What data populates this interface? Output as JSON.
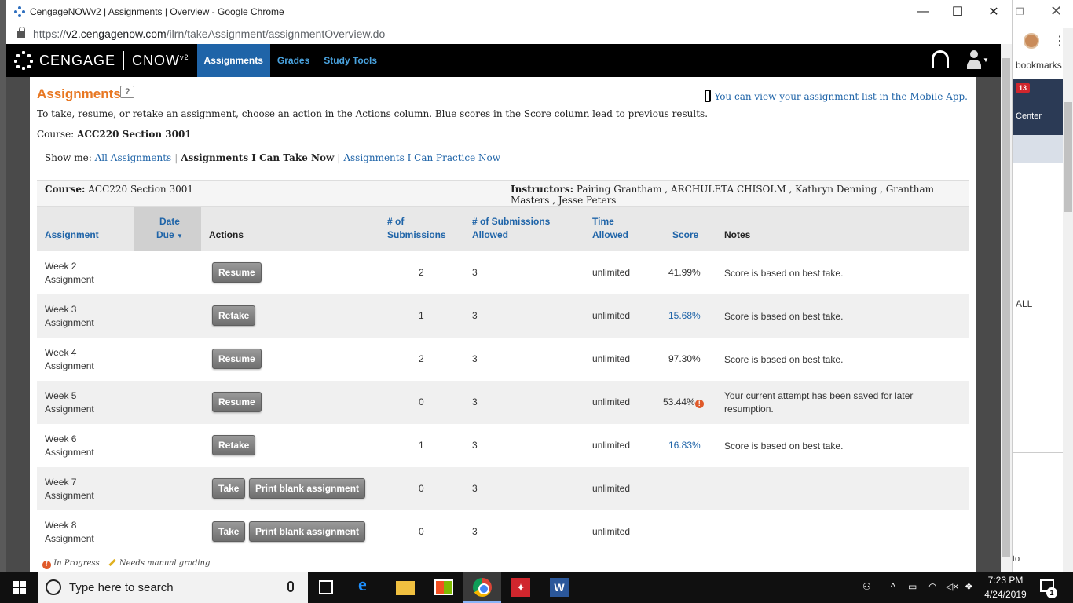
{
  "browser": {
    "title": "CengageNOWv2 | Assignments | Overview - Google Chrome",
    "url_scheme": "https://",
    "url_host": "v2.cengagenow.com",
    "url_path": "/ilrn/takeAssignment/assignmentOverview.do"
  },
  "background_window": {
    "bookmarks": "bookmarks",
    "badge": "13",
    "center_text": "Center",
    "all_text": "ALL",
    "bottom_text": "to"
  },
  "nav": {
    "brand": "CENGAGE",
    "product": "CNOW",
    "product_sup": "v2",
    "tabs": [
      {
        "label": "Assignments"
      },
      {
        "label": "Grades"
      },
      {
        "label": "Study Tools"
      }
    ]
  },
  "page": {
    "title": "Assignments",
    "help": "?",
    "mobile_link": "You can view your assignment list in the Mobile App.",
    "intro": "To take, resume, or retake an assignment, choose an action in the Actions column. Blue scores in the Score column lead to previous results.",
    "course_label": "Course:",
    "course_value": "ACC220 Section 3001",
    "showme_label": "Show me:",
    "showme_all": "All Assignments",
    "showme_current": "Assignments I Can Take Now",
    "showme_practice": "Assignments I Can Practice Now",
    "info_course_label": "Course:",
    "info_course_value": "ACC220 Section 3001",
    "instructors_label": "Instructors:",
    "instructors_value": "Pairing Grantham , ARCHULETA CHISOLM , Kathryn Denning , Grantham Masters , Jesse Peters"
  },
  "table": {
    "headers": {
      "assignment": "Assignment",
      "date_line1": "Date",
      "date_line2": "Due",
      "actions": "Actions",
      "subs_line1": "# of",
      "subs_line2": "Submissions",
      "allowed_line1": "# of Submissions",
      "allowed_line2": "Allowed",
      "time_line1": "Time",
      "time_line2": "Allowed",
      "score": "Score",
      "notes": "Notes"
    },
    "rows": [
      {
        "name1": "Week 2",
        "name2": "Assignment",
        "action": "Resume",
        "action2": "",
        "subs": "2",
        "allowed": "3",
        "time": "unlimited",
        "score": "41.99%",
        "notes": "Score is based on best take."
      },
      {
        "name1": "Week 3",
        "name2": "Assignment",
        "action": "Retake",
        "action2": "",
        "subs": "1",
        "allowed": "3",
        "time": "unlimited",
        "score": "15.68%",
        "notes": "Score is based on best take."
      },
      {
        "name1": "Week 4",
        "name2": "Assignment",
        "action": "Resume",
        "action2": "",
        "subs": "2",
        "allowed": "3",
        "time": "unlimited",
        "score": "97.30%",
        "notes": "Score is based on best take."
      },
      {
        "name1": "Week 5",
        "name2": "Assignment",
        "action": "Resume",
        "action2": "",
        "subs": "0",
        "allowed": "3",
        "time": "unlimited",
        "score": "53.44%",
        "notes": "Your current attempt has been saved for later resumption."
      },
      {
        "name1": "Week 6",
        "name2": "Assignment",
        "action": "Retake",
        "action2": "",
        "subs": "1",
        "allowed": "3",
        "time": "unlimited",
        "score": "16.83%",
        "notes": "Score is based on best take."
      },
      {
        "name1": "Week 7",
        "name2": "Assignment",
        "action": "Take",
        "action2": "Print blank assignment",
        "subs": "0",
        "allowed": "3",
        "time": "unlimited",
        "score": "",
        "notes": ""
      },
      {
        "name1": "Week 8",
        "name2": "Assignment",
        "action": "Take",
        "action2": "Print blank assignment",
        "subs": "0",
        "allowed": "3",
        "time": "unlimited",
        "score": "",
        "notes": ""
      }
    ]
  },
  "legend": {
    "in_progress": "In Progress",
    "manual": "Needs manual grading"
  },
  "taskbar": {
    "search_placeholder": "Type here to search",
    "time": "7:23 PM",
    "date": "4/24/2019",
    "notif_count": "1"
  }
}
